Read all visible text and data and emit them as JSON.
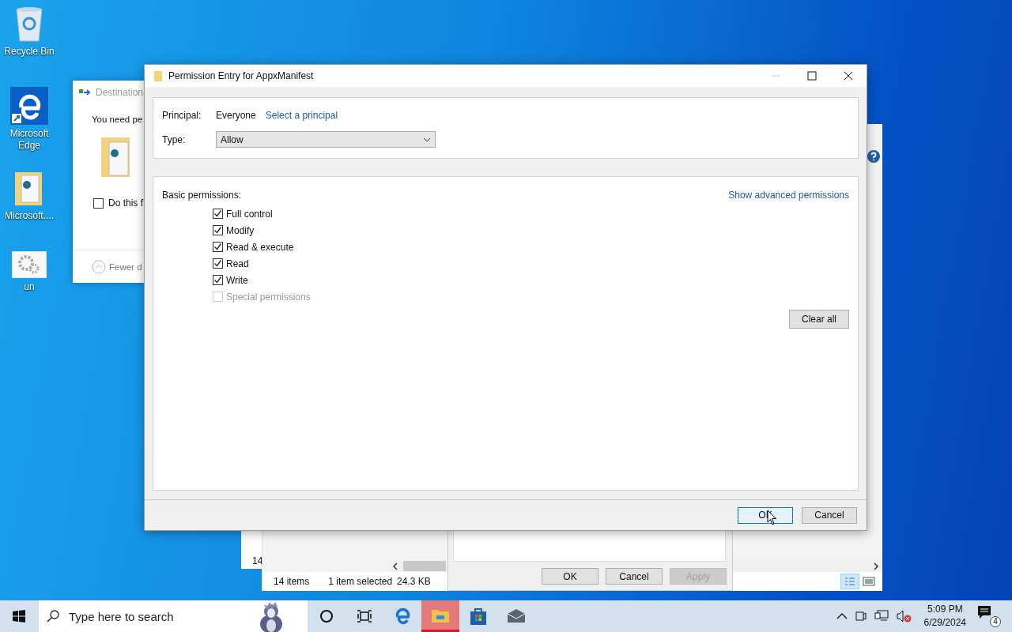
{
  "desktop_icons": [
    {
      "label": "Recycle Bin",
      "kind": "recycle"
    },
    {
      "label": "Microsoft Edge",
      "kind": "edge"
    },
    {
      "label": "Microsoft....",
      "kind": "folder"
    },
    {
      "label": "un",
      "kind": "settings"
    }
  ],
  "back_window": {
    "count": "14"
  },
  "explorer_window": {
    "status_items": "14 items",
    "status_selected": "1 item selected",
    "status_size": "24.3 KB"
  },
  "properties_dialog": {
    "buttons": [
      {
        "label": "OK",
        "disabled": false
      },
      {
        "label": "Cancel",
        "disabled": false
      },
      {
        "label": "Apply",
        "disabled": true
      }
    ]
  },
  "destination_dialog": {
    "title": "Destination",
    "message": "You need pe",
    "checkbox": {
      "label": "Do this f",
      "checked": false
    },
    "toggle": "Fewer d"
  },
  "permission_dialog": {
    "title": "Permission Entry for AppxManifest",
    "principal_label": "Principal:",
    "principal": "Everyone",
    "principal_link": "Select a principal",
    "type_label": "Type:",
    "type_value": "Allow",
    "permissions_label": "Basic permissions:",
    "advanced_link": "Show advanced permissions",
    "permissions": [
      {
        "label": "Full control",
        "checked": true,
        "disabled": false
      },
      {
        "label": "Modify",
        "checked": true,
        "disabled": false
      },
      {
        "label": "Read & execute",
        "checked": true,
        "disabled": false
      },
      {
        "label": "Read",
        "checked": true,
        "disabled": false
      },
      {
        "label": "Write",
        "checked": true,
        "disabled": false
      },
      {
        "label": "Special permissions",
        "checked": false,
        "disabled": true
      }
    ],
    "clear_button": "Clear all",
    "buttons": [
      {
        "label": "OK",
        "focused": true
      },
      {
        "label": "Cancel",
        "focused": false
      }
    ]
  },
  "taskbar": {
    "search_placeholder": "Type here to search",
    "apps": [
      {
        "kind": "cortana",
        "selected": false
      },
      {
        "kind": "taskview",
        "selected": false
      },
      {
        "kind": "edge",
        "selected": false
      },
      {
        "kind": "explorer",
        "selected": true
      },
      {
        "kind": "store",
        "selected": false
      },
      {
        "kind": "mail",
        "selected": false
      }
    ],
    "time": "5:09 PM",
    "date": "6/29/2024",
    "notifications": "4"
  }
}
